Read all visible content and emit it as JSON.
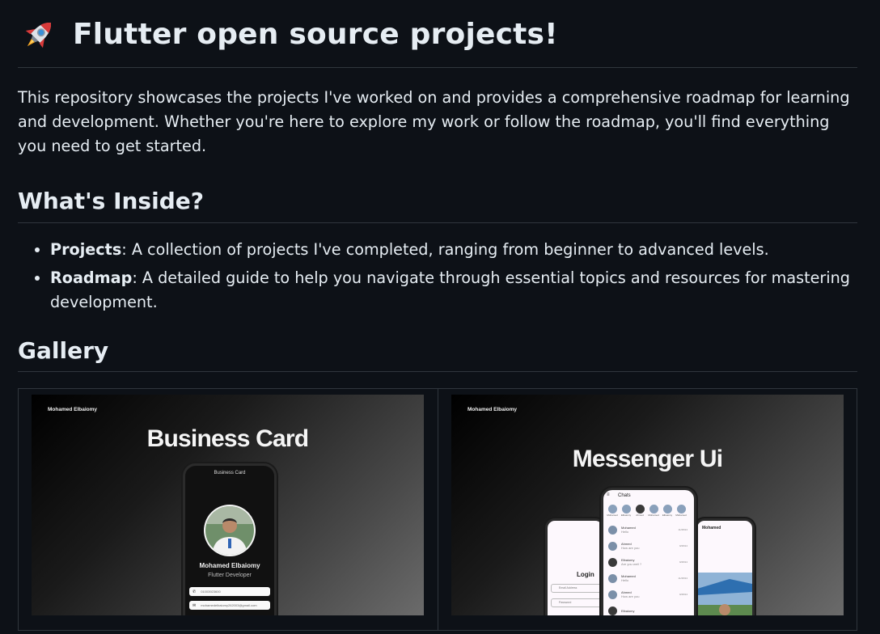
{
  "header": {
    "icon": "rocket-icon",
    "title": "Flutter open source projects!"
  },
  "intro": "This repository showcases the projects I've worked on and provides a comprehensive roadmap for learning and development. Whether you're here to explore my work or follow the roadmap, you'll find everything you need to get started.",
  "inside": {
    "heading": "What's Inside?",
    "items": [
      {
        "term": "Projects",
        "text": ": A collection of projects I've completed, ranging from beginner to advanced levels."
      },
      {
        "term": "Roadmap",
        "text": ": A detailed guide to help you navigate through essential topics and resources for mastering development."
      }
    ]
  },
  "gallery": {
    "heading": "Gallery",
    "items": [
      {
        "author": "Mohamed Elbaiomy",
        "title": "Business Card",
        "phone_header": "Business Card",
        "name": "Mohamed Elbaiomy",
        "role": "Flutter Developer",
        "phone": "01003923600",
        "email": "mohamedelbaiomy262003@gmail.com"
      },
      {
        "author": "Mohamed Elbaiomy",
        "title": "Messenger Ui",
        "screen_title": "Chats",
        "login_label": "Login",
        "email_placeholder": "Email Address",
        "password_placeholder": "Password",
        "right_title": "Mohamed",
        "stories": [
          "Mohamed",
          "Elbaiomy",
          "Ahmed",
          "Mohamed",
          "Elbaiomy",
          "Mohamed"
        ],
        "chats": [
          {
            "name": "Mohamed",
            "msg": "Hello",
            "time": "11/28/24"
          },
          {
            "name": "Ahmed",
            "msg": "How are you",
            "time": "9/28/24"
          },
          {
            "name": "Elbaiomy",
            "msg": "Are you well ?",
            "time": "9/28/24"
          },
          {
            "name": "Mohamed",
            "msg": "Hello",
            "time": "11/28/24"
          },
          {
            "name": "Ahmed",
            "msg": "How are you",
            "time": "9/28/24"
          },
          {
            "name": "Elbaiomy",
            "msg": "",
            "time": ""
          }
        ]
      }
    ]
  },
  "colors": {
    "background": "#0d1117",
    "text": "#e6edf3",
    "border": "#30363d"
  }
}
